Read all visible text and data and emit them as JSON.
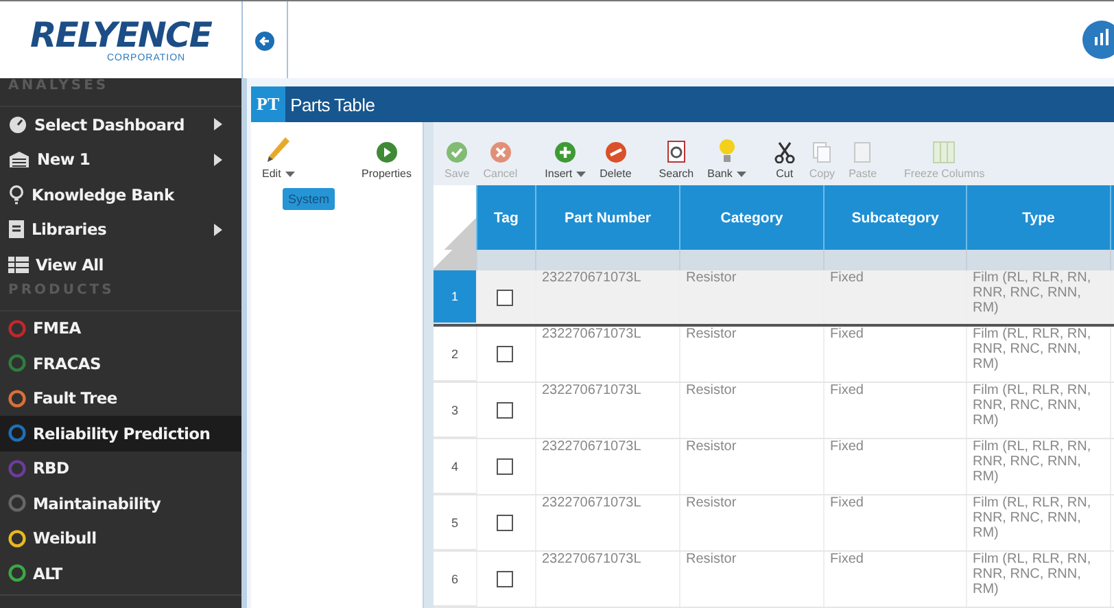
{
  "logo": {
    "name": "RELYENCE",
    "sub": "CORPORATION"
  },
  "sidebar": {
    "sections": [
      {
        "title": "ANALYSES",
        "items": [
          {
            "label": "Select Dashboard",
            "kind": "dashboard",
            "submenu": true,
            "selected": false
          },
          {
            "label": "New 1",
            "kind": "folder",
            "submenu": true,
            "selected": false
          },
          {
            "label": "Knowledge Bank",
            "kind": "bulb",
            "submenu": false,
            "selected": false
          },
          {
            "label": "Libraries",
            "kind": "library",
            "submenu": true,
            "selected": false
          },
          {
            "label": "View All",
            "kind": "list",
            "submenu": false,
            "selected": false
          }
        ]
      },
      {
        "title": "PRODUCTS",
        "items": [
          {
            "label": "FMEA",
            "kind": "product",
            "color": "#c0282d",
            "selected": false
          },
          {
            "label": "FRACAS",
            "kind": "product",
            "color": "#2e7d3e",
            "selected": false
          },
          {
            "label": "Fault Tree",
            "kind": "product",
            "color": "#d9703a",
            "selected": false
          },
          {
            "label": "Reliability Prediction",
            "kind": "product",
            "color": "#1f6fb5",
            "selected": true
          },
          {
            "label": "RBD",
            "kind": "product",
            "color": "#6a3d9a",
            "selected": false
          },
          {
            "label": "Maintainability",
            "kind": "product",
            "color": "#666666",
            "selected": false
          },
          {
            "label": "Weibull",
            "kind": "product",
            "color": "#e8b820",
            "selected": false
          },
          {
            "label": "ALT",
            "kind": "product",
            "color": "#3aa845",
            "selected": false
          }
        ]
      }
    ]
  },
  "panel": {
    "badge": "PT",
    "title": "Parts Table"
  },
  "tree_toolbar": [
    {
      "label": "Edit",
      "kind": "edit",
      "dropdown": true
    },
    {
      "label": "Properties",
      "kind": "properties",
      "dropdown": false
    }
  ],
  "tree": [
    {
      "label": "System",
      "selected": true
    }
  ],
  "grid_toolbar": [
    {
      "label": "Save",
      "kind": "save",
      "disabled": true,
      "dropdown": false
    },
    {
      "label": "Cancel",
      "kind": "cancel",
      "disabled": true,
      "dropdown": false
    },
    {
      "label": "Insert",
      "kind": "insert",
      "disabled": false,
      "dropdown": true
    },
    {
      "label": "Delete",
      "kind": "delete",
      "disabled": false,
      "dropdown": false
    },
    {
      "label": "Search",
      "kind": "search",
      "disabled": false,
      "dropdown": false
    },
    {
      "label": "Bank",
      "kind": "bank",
      "disabled": false,
      "dropdown": true
    },
    {
      "label": "Cut",
      "kind": "cut",
      "disabled": false,
      "dropdown": false
    },
    {
      "label": "Copy",
      "kind": "copy",
      "disabled": true,
      "dropdown": false
    },
    {
      "label": "Paste",
      "kind": "paste",
      "disabled": true,
      "dropdown": false
    },
    {
      "label": "Freeze Columns",
      "kind": "freeze",
      "disabled": true,
      "dropdown": false
    }
  ],
  "table": {
    "columns": [
      "Tag",
      "Part Number",
      "Category",
      "Subcategory",
      "Type"
    ],
    "rows": [
      {
        "number": "1",
        "selected": true,
        "tag": false,
        "part_number": "232270671073L",
        "category": "Resistor",
        "subcategory": "Fixed",
        "type": "Film (RL, RLR, RN, RNR, RNC, RNN, RM)"
      },
      {
        "number": "2",
        "selected": false,
        "tag": false,
        "part_number": "232270671073L",
        "category": "Resistor",
        "subcategory": "Fixed",
        "type": "Film (RL, RLR, RN, RNR, RNC, RNN, RM)"
      },
      {
        "number": "3",
        "selected": false,
        "tag": false,
        "part_number": "232270671073L",
        "category": "Resistor",
        "subcategory": "Fixed",
        "type": "Film (RL, RLR, RN, RNR, RNC, RNN, RM)"
      },
      {
        "number": "4",
        "selected": false,
        "tag": false,
        "part_number": "232270671073L",
        "category": "Resistor",
        "subcategory": "Fixed",
        "type": "Film (RL, RLR, RN, RNR, RNC, RNN, RM)"
      },
      {
        "number": "5",
        "selected": false,
        "tag": false,
        "part_number": "232270671073L",
        "category": "Resistor",
        "subcategory": "Fixed",
        "type": "Film (RL, RLR, RN, RNR, RNC, RNN, RM)"
      },
      {
        "number": "6",
        "selected": false,
        "tag": false,
        "part_number": "232270671073L",
        "category": "Resistor",
        "subcategory": "Fixed",
        "type": "Film (RL, RLR, RN, RNR, RNC, RNN, RM)"
      }
    ]
  }
}
